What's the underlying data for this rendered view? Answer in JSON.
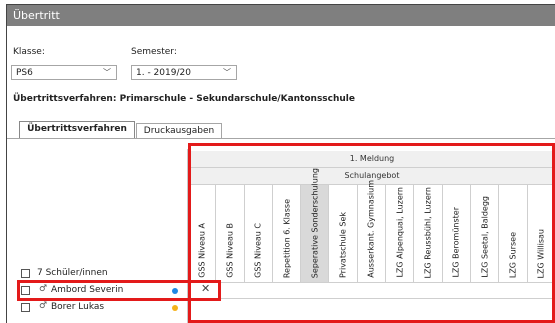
{
  "window": {
    "title": "Übertritt"
  },
  "form": {
    "klasse_label": "Klasse:",
    "klasse_value": "PS6",
    "semester_label": "Semester:",
    "semester_value": "1. - 2019/20",
    "verfahren_heading": "Übertrittsverfahren: Primarschule - Sekundarschule/Kantonsschule"
  },
  "tabs": [
    {
      "label": "Übertrittsverfahren",
      "active": true
    },
    {
      "label": "Druckausgaben",
      "active": false
    }
  ],
  "grid": {
    "group_header": "1. Meldung",
    "sub_header": "Schulangebot",
    "columns": [
      "GSS Niveau A",
      "GSS Niveau B",
      "GSS Niveau C",
      "Repetition 6. Klasse",
      "Seperative Sonderschulung",
      "Privatschule Sek",
      "Ausserkant. Gymnasium",
      "LZG Alpenquai, Luzern",
      "LZG Reussbühl, Luzern",
      "LZG Beromünster",
      "LZG Seetal, Baldegg",
      "LZG Sursee",
      "LZG Willisau"
    ],
    "count_label": "7 Schüler/innen",
    "students": [
      {
        "name": "Ambord Severin",
        "gender_symbol": "♂",
        "dot_color": "#1e88e5",
        "mark": "✕"
      },
      {
        "name": "Borer Lukas",
        "gender_symbol": "♂",
        "dot_color": "#f5b21b",
        "mark": ""
      }
    ]
  },
  "colors": {
    "highlight": "#e31a1a",
    "titlebar": "#7f7f7f",
    "sonder_column": "#d9d9d9"
  }
}
